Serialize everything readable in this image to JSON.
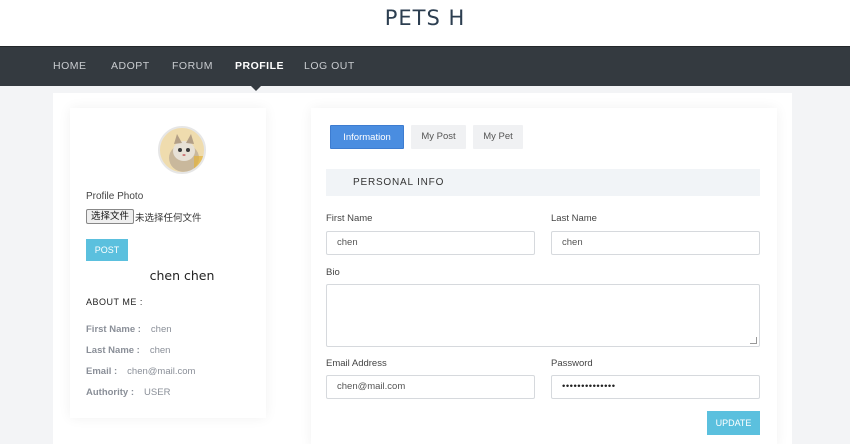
{
  "app": {
    "title": "PETS H"
  },
  "nav": {
    "items": [
      {
        "label": "HOME"
      },
      {
        "label": "ADOPT"
      },
      {
        "label": "FORUM"
      },
      {
        "label": "PROFILE"
      },
      {
        "label": "LOG OUT"
      }
    ],
    "active": "PROFILE"
  },
  "profile": {
    "photo_label": "Profile Photo",
    "file_button": "选择文件",
    "file_status": "未选择任何文件",
    "post_label": "POST",
    "display_name": "chen chen",
    "about_label": "ABOUT ME :",
    "details": [
      {
        "key": "First Name :",
        "value": "chen"
      },
      {
        "key": "Last Name :",
        "value": "chen"
      },
      {
        "key": "Email :",
        "value": "chen@mail.com"
      },
      {
        "key": "Authority :",
        "value": "USER"
      }
    ]
  },
  "tabs": [
    {
      "label": "Information",
      "active": true
    },
    {
      "label": "My Post",
      "active": false
    },
    {
      "label": "My Pet",
      "active": false
    }
  ],
  "form": {
    "section_title": "PERSONAL INFO",
    "first_name": {
      "label": "First Name",
      "value": "chen"
    },
    "last_name": {
      "label": "Last Name",
      "value": "chen"
    },
    "bio": {
      "label": "Bio",
      "value": ""
    },
    "email": {
      "label": "Email Address",
      "value": "chen@mail.com"
    },
    "password": {
      "label": "Password",
      "value": "••••••••••••••"
    },
    "update_label": "UPDATE"
  },
  "colors": {
    "nav_bg": "#343a40",
    "accent_blue": "#4a8de0",
    "button_cyan": "#5bc0de"
  },
  "icons": {
    "avatar": "cat-photo"
  }
}
